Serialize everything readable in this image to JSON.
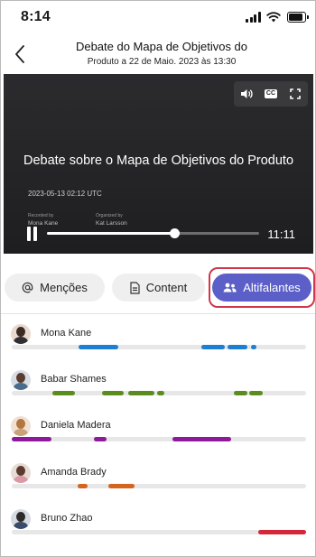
{
  "status_bar": {
    "time": "8:14"
  },
  "header": {
    "title_line1": "Debate do Mapa de Objetivos do",
    "title_line2": "Produto a 22 de Maio. 2023 às 13:30"
  },
  "video": {
    "title": "Debate sobre o Mapa de Objetivos do Produto",
    "date": "2023-05-13 02:12 UTC",
    "recorded_by_label": "Recorded by",
    "recorded_by": "Mona Kane",
    "organized_by_label": "Organized by",
    "organized_by": "Kat Larsson",
    "duration": "11:11",
    "progress": 0.6,
    "controls": [
      "volume-icon",
      "closed-captions-icon",
      "fullscreen-icon"
    ],
    "cc_label": "CC"
  },
  "tabs": [
    {
      "label": "Menções",
      "icon": "at-icon"
    },
    {
      "label": "Content",
      "icon": "document-icon"
    },
    {
      "label": "Altifalantes",
      "icon": "people-icon",
      "selected": true
    }
  ],
  "colors": {
    "accent": "#5b5fc7",
    "highlight_outline": "#d1374a"
  },
  "speakers": [
    {
      "name": "Mona Kane",
      "color": "#1d7fd3",
      "segments": [
        [
          0.228,
          0.362
        ],
        [
          0.644,
          0.725
        ],
        [
          0.733,
          0.802
        ],
        [
          0.814,
          0.832
        ]
      ]
    },
    {
      "name": "Babar Shames",
      "color": "#5b8c1e",
      "segments": [
        [
          0.138,
          0.215
        ],
        [
          0.307,
          0.38
        ],
        [
          0.396,
          0.485
        ],
        [
          0.494,
          0.518
        ],
        [
          0.755,
          0.8
        ],
        [
          0.807,
          0.853
        ]
      ]
    },
    {
      "name": "Daniela Madera",
      "color": "#8e1a9b",
      "segments": [
        [
          0.0,
          0.135
        ],
        [
          0.28,
          0.322
        ],
        [
          0.546,
          0.745
        ]
      ]
    },
    {
      "name": "Amanda Brady",
      "color": "#d3651f",
      "segments": [
        [
          0.224,
          0.258
        ],
        [
          0.328,
          0.417
        ]
      ]
    },
    {
      "name": "Bruno Zhao",
      "color": "#d2283a",
      "segments": [
        [
          0.837,
          1.0
        ]
      ]
    }
  ]
}
